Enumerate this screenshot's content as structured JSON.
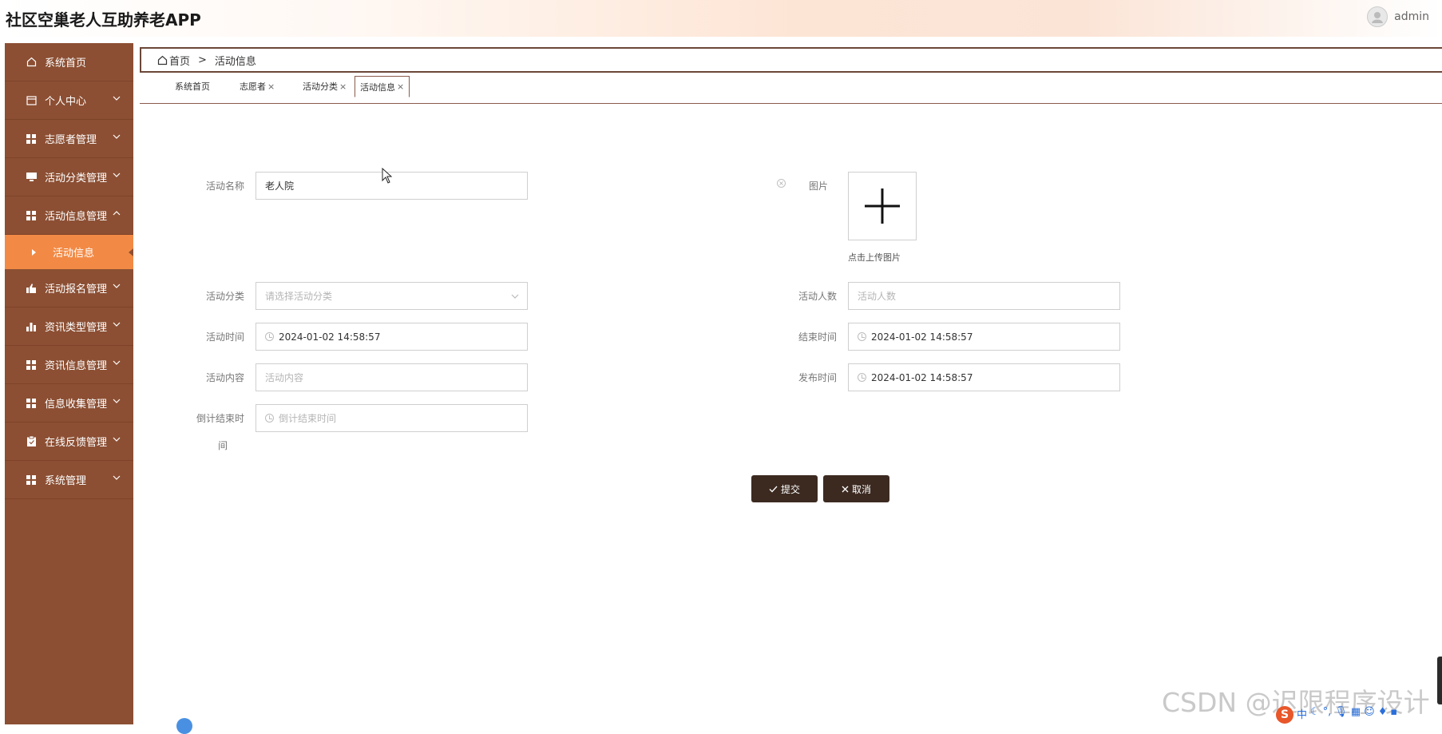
{
  "header": {
    "title": "社区空巢老人互助养老APP",
    "username": "admin"
  },
  "sidebar": {
    "items": [
      {
        "label": "系统首页",
        "icon": "home-icon",
        "chevron": ""
      },
      {
        "label": "个人中心",
        "icon": "calendar-icon",
        "chevron": "down"
      },
      {
        "label": "志愿者管理",
        "icon": "grid-icon",
        "chevron": "down"
      },
      {
        "label": "活动分类管理",
        "icon": "monitor-icon",
        "chevron": "down"
      },
      {
        "label": "活动信息管理",
        "icon": "grid-icon",
        "chevron": "up"
      },
      {
        "label": "活动报名管理",
        "icon": "thumb-icon",
        "chevron": "down"
      },
      {
        "label": "资讯类型管理",
        "icon": "bar-chart-icon",
        "chevron": "down"
      },
      {
        "label": "资讯信息管理",
        "icon": "grid-icon",
        "chevron": "down"
      },
      {
        "label": "信息收集管理",
        "icon": "grid-icon",
        "chevron": "down"
      },
      {
        "label": "在线反馈管理",
        "icon": "clipboard-icon",
        "chevron": "down"
      },
      {
        "label": "系统管理",
        "icon": "grid-icon",
        "chevron": "down"
      }
    ],
    "active_sub": "活动信息"
  },
  "breadcrumb": {
    "home": "首页",
    "separator": ">",
    "current": "活动信息"
  },
  "tabs": [
    {
      "label": "系统首页",
      "closable": false
    },
    {
      "label": "志愿者",
      "closable": true
    },
    {
      "label": "活动分类",
      "closable": true
    },
    {
      "label": "活动信息",
      "closable": true,
      "active": true
    }
  ],
  "tab_close_glyph": "×",
  "form": {
    "name": {
      "label": "活动名称",
      "value": "老人院"
    },
    "image": {
      "label": "图片",
      "hint": "点击上传图片"
    },
    "category": {
      "label": "活动分类",
      "placeholder": "请选择活动分类"
    },
    "count": {
      "label": "活动人数",
      "placeholder": "活动人数"
    },
    "start_time": {
      "label": "活动时间",
      "value": "2024-01-02 14:58:57"
    },
    "end_time": {
      "label": "结束时间",
      "value": "2024-01-02 14:58:57"
    },
    "content": {
      "label": "活动内容",
      "placeholder": "活动内容"
    },
    "publish_time": {
      "label": "发布时间",
      "value": "2024-01-02 14:58:57"
    },
    "countdown": {
      "label_line1": "倒计结束时",
      "label_line2": "间",
      "placeholder": "倒计结束时间"
    }
  },
  "buttons": {
    "submit": "提交",
    "cancel": "取消"
  },
  "overlay": {
    "watermark": "CSDN @迟限程序设计",
    "ime_logo": "S",
    "ime_lang": "中"
  },
  "colors": {
    "sidebar_bg": "#8c4f33",
    "active_sub_bg": "#f28a45",
    "button_bg": "#3c2a21",
    "border_accent": "#6b4738"
  }
}
